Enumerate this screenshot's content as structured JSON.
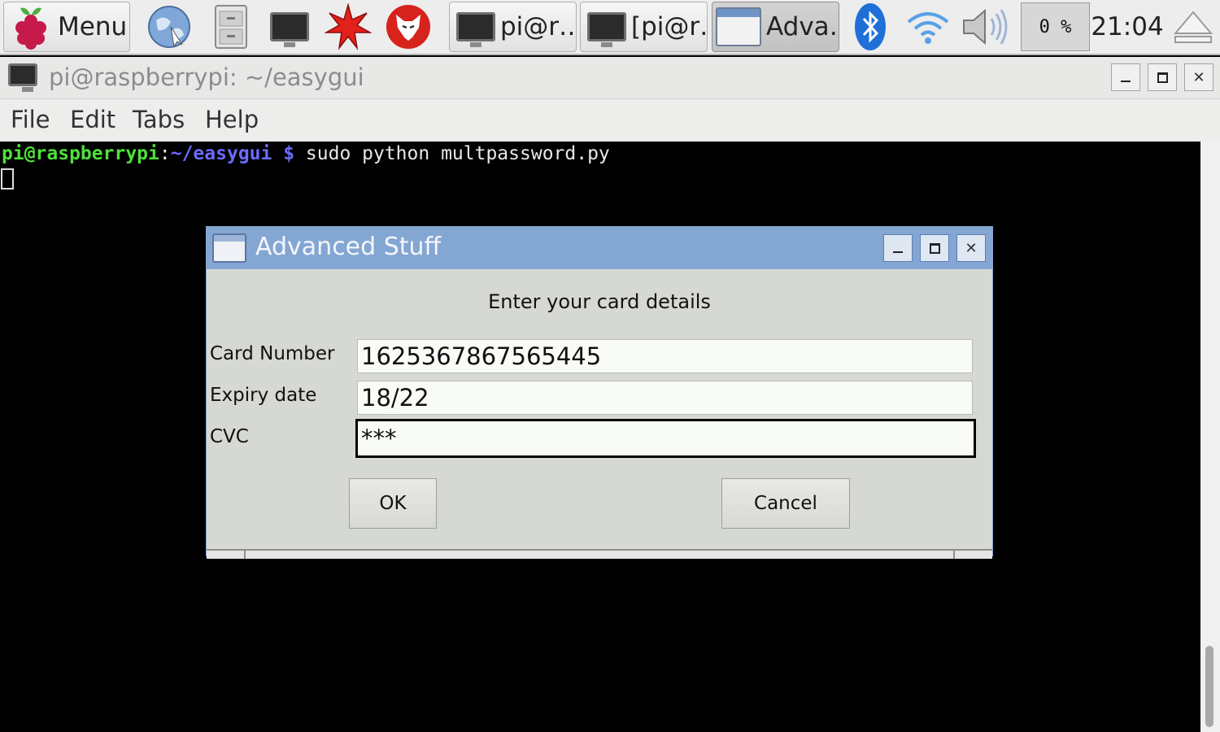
{
  "taskbar": {
    "menu_label": "Menu",
    "tasks": [
      {
        "label": "pi@r…",
        "icon": "terminal-icon"
      },
      {
        "label": "[pi@r…",
        "icon": "terminal-icon"
      },
      {
        "label": "Adva…",
        "icon": "window-icon",
        "active": true
      }
    ],
    "cpu": "0 %",
    "clock": "21:04"
  },
  "terminal": {
    "title": "pi@raspberrypi: ~/easygui",
    "menu": [
      "File",
      "Edit",
      "Tabs",
      "Help"
    ],
    "prompt_user": "pi@raspberrypi",
    "prompt_sep": ":",
    "prompt_path": "~/easygui",
    "prompt_sym": " $",
    "command": " sudo python multpassword.py"
  },
  "dialog": {
    "title": "Advanced Stuff",
    "message": "Enter your card details",
    "fields": [
      {
        "label": "Card Number",
        "value": "1625367867565445"
      },
      {
        "label": "Expiry date",
        "value": "18/22"
      },
      {
        "label": "CVC",
        "value": "***"
      }
    ],
    "ok_label": "OK",
    "cancel_label": "Cancel"
  },
  "colors": {
    "dialog_titlebar": "#84a6d3",
    "prompt_user": "#4fe03a",
    "prompt_path": "#6b6bff"
  }
}
